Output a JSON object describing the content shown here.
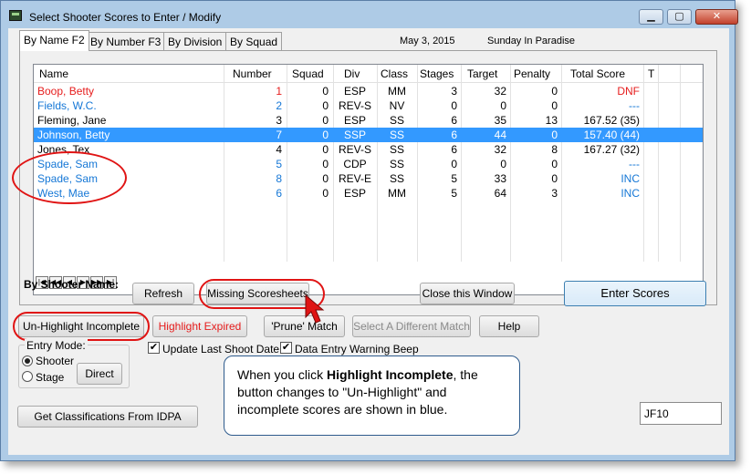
{
  "window": {
    "title": "Select Shooter Scores to Enter / Modify"
  },
  "tabs": [
    {
      "label": "By Name F2"
    },
    {
      "label": "By Number F3"
    },
    {
      "label": "By Division"
    },
    {
      "label": "By Squad"
    }
  ],
  "header": {
    "date": "May  3, 2015",
    "match_name": "Sunday In Paradise"
  },
  "grid": {
    "columns": [
      "Name",
      "Number",
      "Squad",
      "Div",
      "Class",
      "Stages",
      "Target",
      "Penalty",
      "Total Score",
      "T"
    ],
    "rows": [
      {
        "name": "Boop, Betty",
        "number": "1",
        "squad": "0",
        "div": "ESP",
        "class": "MM",
        "stages": "3",
        "target": "32",
        "penalty": "0",
        "total": "DNF",
        "style": "red"
      },
      {
        "name": "Fields, W.C.",
        "number": "2",
        "squad": "0",
        "div": "REV-S",
        "class": "NV",
        "stages": "0",
        "target": "0",
        "penalty": "0",
        "total": "---",
        "style": "blue"
      },
      {
        "name": "Fleming, Jane",
        "number": "3",
        "squad": "0",
        "div": "ESP",
        "class": "SS",
        "stages": "6",
        "target": "35",
        "penalty": "13",
        "total": "167.52 (35)",
        "style": "black"
      },
      {
        "name": "Johnson, Betty",
        "number": "7",
        "squad": "0",
        "div": "SSP",
        "class": "SS",
        "stages": "6",
        "target": "44",
        "penalty": "0",
        "total": "157.40 (44)",
        "style": "selected"
      },
      {
        "name": "Jones, Tex",
        "number": "4",
        "squad": "0",
        "div": "REV-S",
        "class": "SS",
        "stages": "6",
        "target": "32",
        "penalty": "8",
        "total": "167.27 (32)",
        "style": "black"
      },
      {
        "name": "Spade, Sam",
        "number": "5",
        "squad": "0",
        "div": "CDP",
        "class": "SS",
        "stages": "0",
        "target": "0",
        "penalty": "0",
        "total": "---",
        "style": "blue"
      },
      {
        "name": "Spade, Sam",
        "number": "8",
        "squad": "0",
        "div": "REV-E",
        "class": "SS",
        "stages": "5",
        "target": "33",
        "penalty": "0",
        "total": "INC",
        "style": "blue"
      },
      {
        "name": "West, Mae",
        "number": "6",
        "squad": "0",
        "div": "ESP",
        "class": "MM",
        "stages": "5",
        "target": "64",
        "penalty": "3",
        "total": "INC",
        "style": "blue"
      }
    ],
    "nav_buttons": [
      "|◀",
      "◀◀",
      "◀",
      "▶",
      "▶▶",
      "▶|"
    ]
  },
  "buttons": {
    "by_shooter_name_label": "By Shooter Name:",
    "refresh": "Refresh",
    "missing_scoresheets": "Missing Scoresheets",
    "close_window": "Close this Window",
    "enter_scores": "Enter Scores",
    "unhighlight_incomplete": "Un-Highlight Incomplete",
    "highlight_expired": "Highlight Expired",
    "prune_match": "'Prune' Match",
    "select_different_match": "Select A Different  Match",
    "help": "Help",
    "direct": "Direct",
    "get_classifications": "Get Classifications From IDPA"
  },
  "entry_mode": {
    "label": "Entry Mode:",
    "options": [
      "Shooter",
      "Stage"
    ],
    "selected": "Shooter"
  },
  "checkboxes": {
    "update_last_shoot_date": {
      "label": "Update Last Shoot Date",
      "checked": true
    },
    "data_entry_warning_beep": {
      "label": "Data Entry Warning Beep",
      "checked": true
    }
  },
  "callout": {
    "prefix": "When you click ",
    "bold": "Highlight Incomplete",
    "suffix": ", the button changes to \"Un-Highlight\" and incomplete scores are shown in blue."
  },
  "id_field": {
    "value": "JF10"
  },
  "colors": {
    "red": "#e61d1d",
    "blue": "#1577d6",
    "selected": "#3399ff",
    "annotation": "#e01414"
  }
}
